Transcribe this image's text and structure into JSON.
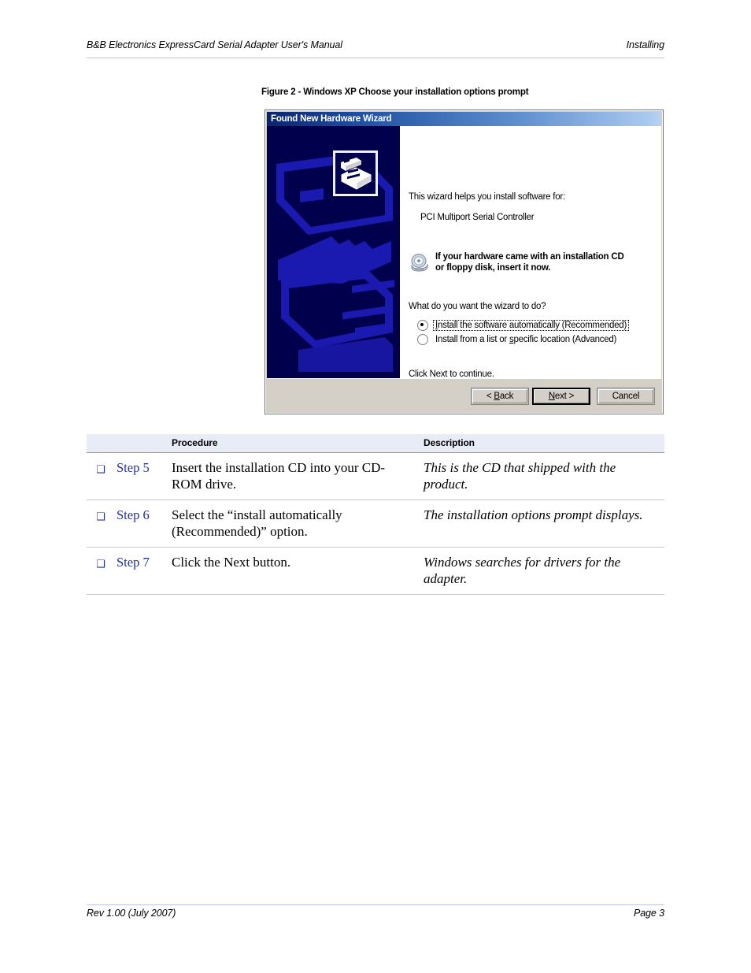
{
  "header": {
    "left": "B&B Electronics ExpressCard Serial Adapter User's Manual",
    "right": "Installing"
  },
  "figure": {
    "caption": "Figure 2 - Windows XP Choose your installation options prompt"
  },
  "dialog": {
    "title": "Found New Hardware Wizard",
    "intro": "This wizard helps you install software for:",
    "device": "PCI Multiport Serial Controller",
    "cd_note_line1": "If your hardware came with an installation CD",
    "cd_note_line2": "or floppy disk, insert it now.",
    "question": "What do you want the wizard to do?",
    "options": [
      {
        "label": "Install the software automatically (Recommended)",
        "accel": "I",
        "selected": true,
        "focused": true
      },
      {
        "label": "Install from a list or specific location (Advanced)",
        "accel": "s",
        "selected": false,
        "focused": false
      }
    ],
    "footer_text": "Click Next to continue.",
    "buttons": [
      {
        "label": "< Back",
        "accel": "B",
        "default": false
      },
      {
        "label": "Next >",
        "accel": "N",
        "default": true
      },
      {
        "label": "Cancel",
        "accel": "",
        "default": false
      }
    ],
    "colors": {
      "titlebar_start": "#0a246a",
      "titlebar_end": "#b6d2f3",
      "watermark_bg": "#00004c",
      "watermark_graphic": "#1a1ab0",
      "face": "#d4d0c8"
    }
  },
  "procedure_table": {
    "columns": [
      "",
      "",
      "Procedure",
      "Description"
    ],
    "checkbox_glyph": "❑",
    "rows": [
      {
        "step": "Step 5",
        "procedure": "Insert the installation CD into your CD-ROM drive.",
        "description": "This is the CD that shipped with the product."
      },
      {
        "step": "Step 6",
        "procedure": "Select the “install automatically (Recommended)” option.",
        "description": "The installation options prompt displays."
      },
      {
        "step": "Step 7",
        "procedure": "Click the Next button.",
        "description": "Windows searches for drivers for the adapter."
      }
    ]
  },
  "footer": {
    "left": "Rev 1.00  (July 2007)",
    "right": "Page 3"
  }
}
